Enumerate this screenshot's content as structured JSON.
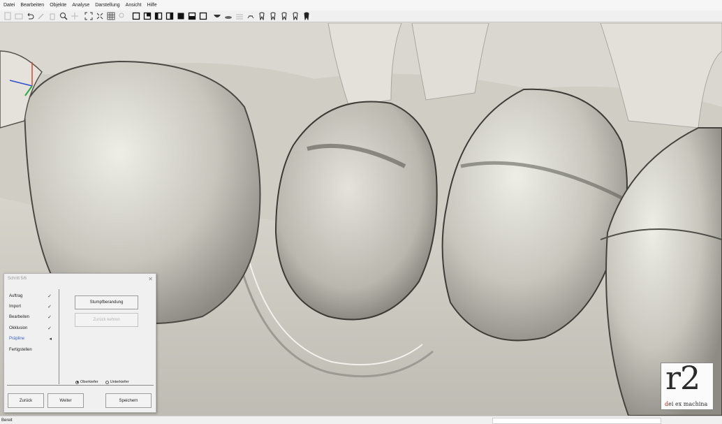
{
  "menu": [
    "Datei",
    "Bearbeiten",
    "Objekte",
    "Analyse",
    "Darstellung",
    "Ansicht",
    "Hilfe"
  ],
  "toolbar": {
    "buttons": [
      "undo-icon",
      "redo-icon",
      "zoom-icon",
      "pan-icon",
      "fit-view-icon",
      "grid-icon",
      "search-icon",
      "view-front-icon",
      "view-back-icon",
      "view-left-icon",
      "view-right-icon",
      "view-top-icon",
      "view-bottom-icon",
      "bowl-icon",
      "plate-icon",
      "mesh-icon",
      "tooth-icon",
      "tooth-icon",
      "tooth-icon",
      "tooth-icon",
      "tooth-icon"
    ]
  },
  "wizard": {
    "title": "Schritt 5/6",
    "steps": [
      {
        "label": "Auftrag",
        "mark": "✓"
      },
      {
        "label": "Import",
        "mark": "✓"
      },
      {
        "label": "Bearbeiten",
        "mark": "✓"
      },
      {
        "label": "Okklusion",
        "mark": "✓"
      },
      {
        "label": "Präpline",
        "mark": "◂"
      },
      {
        "label": "Fertigstellen",
        "mark": ""
      }
    ],
    "active_step": 4,
    "action_button": "Stumpfberandung",
    "action_button_disabled": "Zurück kehren",
    "radio_upper": "Oberkiefer",
    "radio_lower": "Unterkiefer",
    "back_label": "Zurück",
    "next_label": "Weiter",
    "save_label": "Speichern"
  },
  "status": {
    "text": "Bereit"
  },
  "logo": {
    "mark": "r2",
    "sub_prefix": "d",
    "sub_rest": "ei ex machina"
  },
  "colors": {
    "background": "#d8d6cf",
    "active_step": "#3b62c4",
    "logo_red": "#b9231b"
  }
}
